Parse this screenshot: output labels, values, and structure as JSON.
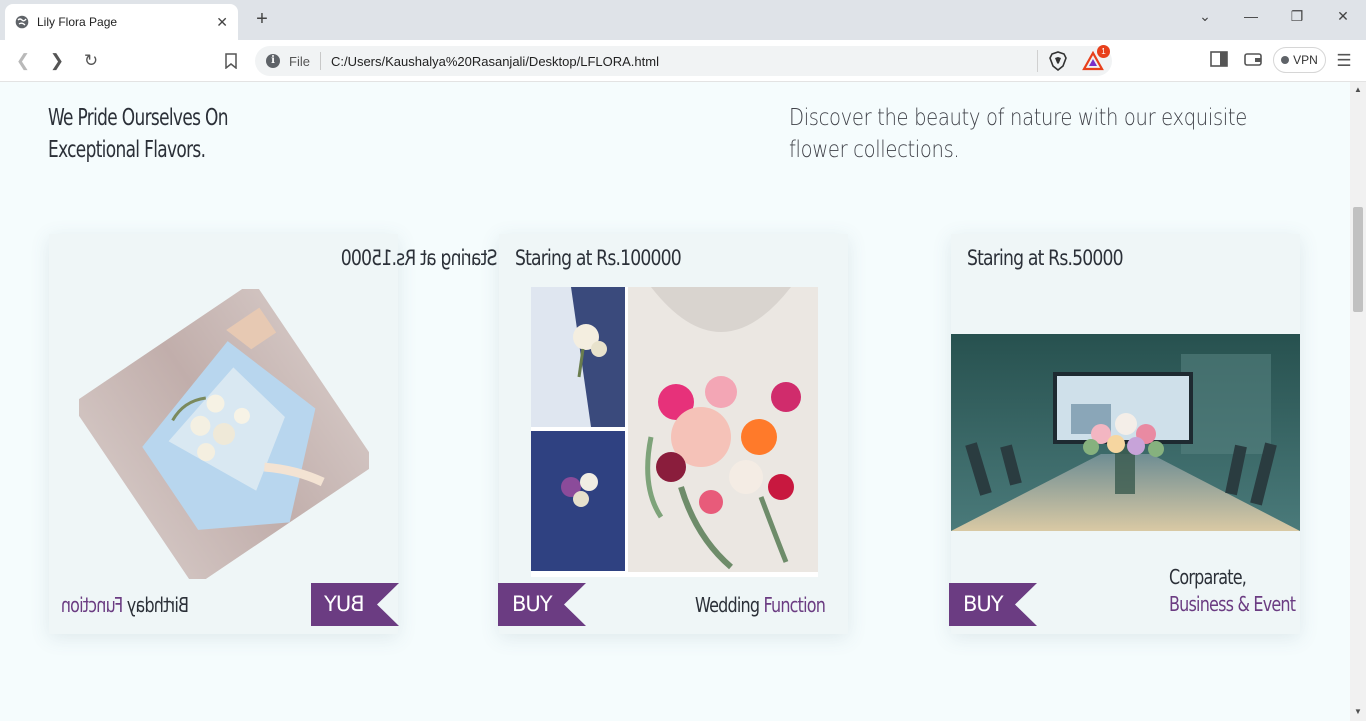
{
  "browser": {
    "tab_title": "Lily Flora Page",
    "address_scheme": "File",
    "address_url": "C:/Users/Kaushalya%20Rasanjali/Desktop/LFLORA.html",
    "rewards_badge": "1",
    "vpn_label": "VPN"
  },
  "page": {
    "heading_left": "We Pride Ourselves On Exceptional Flavors.",
    "heading_right": "Discover the beauty of nature with our exquisite flower collections.",
    "cards": [
      {
        "price": "Staring at Rs.15000",
        "caption_main": "Birthday",
        "caption_accent": "Function",
        "buy_label": "BUY",
        "mirrored": true
      },
      {
        "price": "Staring at Rs.100000",
        "caption_main": "Wedding",
        "caption_accent": "Function",
        "buy_label": "BUY",
        "mirrored": false
      },
      {
        "price": "Staring at Rs.50000",
        "caption_line1": "Corparate,",
        "caption_accent": "Business & Event",
        "buy_label": "BUY",
        "mirrored": false
      }
    ]
  },
  "colors": {
    "accent_purple": "#6b3c82",
    "page_background": "#f5fcfd",
    "card_background": "#eff6f7"
  },
  "icons": [
    "globe-icon",
    "close-icon",
    "plus-icon",
    "back-icon",
    "forward-icon",
    "reload-icon",
    "bookmark-icon",
    "info-icon",
    "brave-shield-icon",
    "brave-rewards-icon",
    "sidebar-icon",
    "wallet-icon",
    "menu-icon"
  ]
}
